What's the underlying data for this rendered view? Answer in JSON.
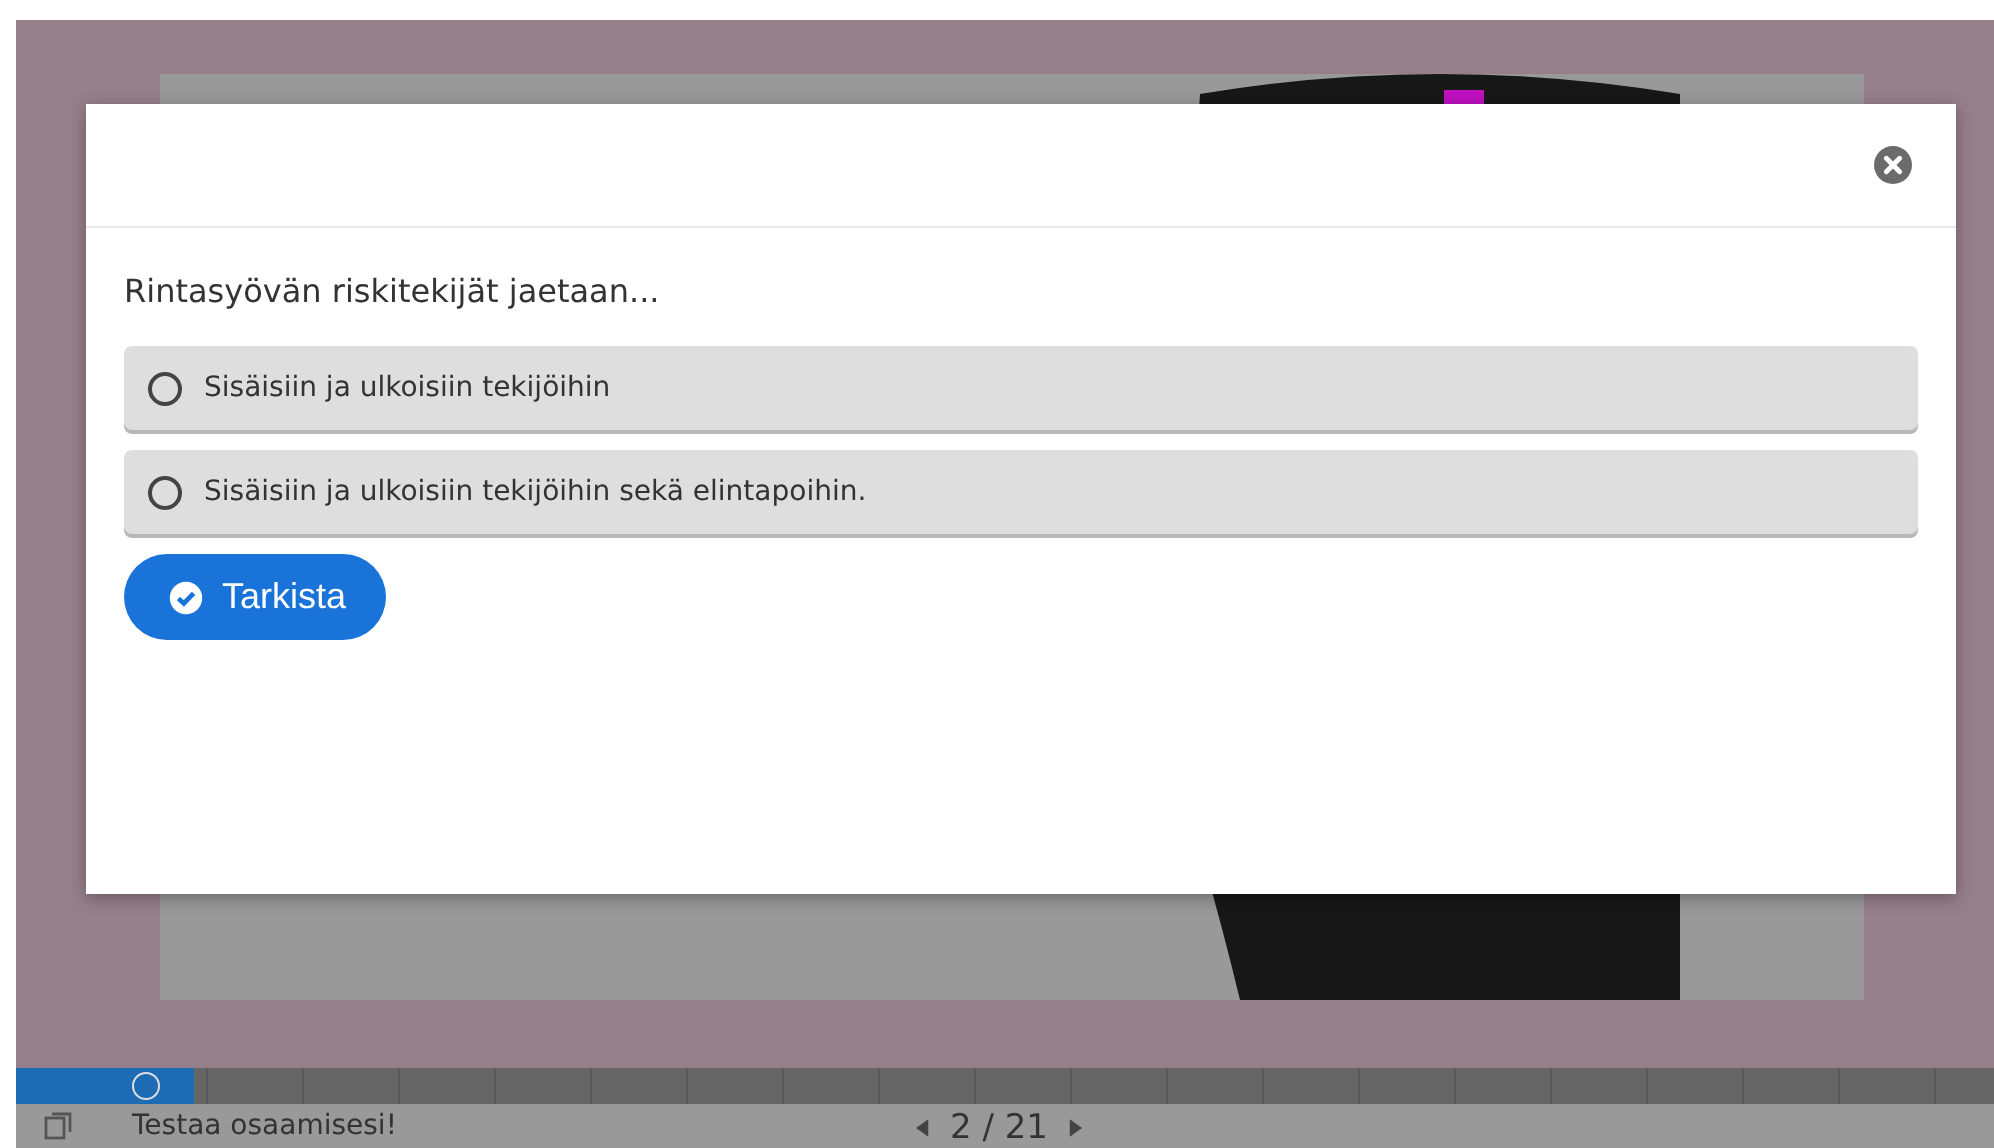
{
  "dialog": {
    "question": "Rintasyövän riskitekijät jaetaan...",
    "options": [
      {
        "label": "Sisäisiin ja ulkoisiin tekijöihin",
        "selected": false
      },
      {
        "label": "Sisäisiin ja ulkoisiin tekijöihin sekä elintapoihin.",
        "selected": false
      }
    ],
    "check_button": "Tarkista"
  },
  "progress": {
    "level": 0.09
  },
  "footer": {
    "title": "Testaa osaamisesi!",
    "page": "2 / 21"
  }
}
